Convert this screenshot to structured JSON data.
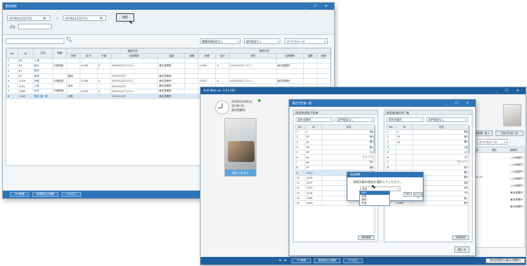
{
  "back_window": {
    "title": "勤怠検索",
    "controls": "_ ☐ ×",
    "date_from": "2019年12月27日",
    "date_to": "2019年12月27日",
    "range_sep": "〜",
    "name_label": "氏名",
    "search_button": "検索",
    "filters": [
      "職種所属指定なし",
      "部門指定なし",
      "すべてのデータ"
    ],
    "col_headers": {
      "no": "No.",
      "id": "ID",
      "name": "氏名",
      "work": "勤務",
      "group_left": "最新打刻",
      "group_right": "最終打刻",
      "sub": [
        "状態",
        "区分",
        "日時",
        "出勤場所",
        "温度",
        "画像"
      ]
    },
    "rows": [
      {
        "no": "1",
        "id": "98",
        "name": "小澤",
        "work": "",
        "state": "",
        "num": "",
        "cls": "",
        "time": "",
        "place": "",
        "r_num": "",
        "r_cls": "",
        "r_time": "",
        "r_place": ""
      },
      {
        "no": "2",
        "id": "66",
        "name": "藤木",
        "work": "中勤測定",
        "state": "",
        "num": "0.000",
        "cls": "A",
        "time": "2019/12/27 07:3...",
        "place": "東京営業所",
        "r_num": "0.000",
        "r_cls": "A",
        "r_time": "2019/12/27 17:1...",
        "r_place": "東京営業所"
      },
      {
        "no": "3",
        "id": "67",
        "name": "藤林",
        "work": "",
        "state": "",
        "num": "",
        "cls": "",
        "time": "",
        "place": "",
        "r_num": "",
        "r_cls": "",
        "r_time": "",
        "r_place": ""
      },
      {
        "no": "4",
        "id": "67",
        "name": "藤林",
        "work": "",
        "state": "遅刻",
        "num": "",
        "cls": "",
        "time": "2019/12/27",
        "place": "東京営業所",
        "r_num": "",
        "r_cls": "",
        "r_time": "",
        "r_place": ""
      },
      {
        "no": "5",
        "id": "1029",
        "name": "伊藤",
        "work": "中勤測定",
        "state": "",
        "num": "0.000",
        "cls": "A",
        "time": "2019/12/27 07:3...",
        "place": "東京営業所",
        "r_num": "0.000",
        "r_cls": "A",
        "r_time": "2019/12/27 17:1...",
        "r_place": "東京営業所"
      },
      {
        "no": "6",
        "id": "1051",
        "name": "九条",
        "work": "",
        "state": "休み",
        "num": "",
        "cls": "",
        "time": "2019/12/27",
        "place": "東京営業所",
        "r_num": "",
        "r_cls": "",
        "r_time": "",
        "r_place": ""
      },
      {
        "no": "7",
        "id": "1083",
        "name": "木村",
        "work": "中勤測定",
        "state": "",
        "num": "0.000",
        "cls": "A",
        "time": "2019/12/27 07:3...",
        "place": "東京営業所",
        "r_num": "",
        "r_cls": "",
        "r_time": "",
        "r_place": ""
      },
      {
        "no": "8",
        "id": "1139",
        "name": "野倉 康一郎",
        "work": "",
        "state": "出張",
        "num": "",
        "cls": "",
        "time": "2019/12/27",
        "place": "東京営業所",
        "r_num": "",
        "r_cls": "",
        "r_time": "",
        "r_place": ""
      }
    ],
    "bottom_buttons": [
      "TCP帳票",
      "勤務表出力帳票",
      "CSV出力"
    ]
  },
  "front_window": {
    "title": "ALD Web ver. 3.01.001",
    "controls": "_ ☐ ×",
    "date_line": "2019/12/26(木)",
    "time_line": "16:09:10",
    "place_line": "東京営業所",
    "camera_caption": "測定できます",
    "right_filters": [
      "勤務管理帳票一覧 ▸",
      "測定予定者一覧",
      "すべてのデータ"
    ],
    "right_cols": [
      "出社",
      "退社",
      "勤務所"
    ],
    "right_rows": [
      "□川東営所",
      "□川東営所",
      "□川東営所",
      "□川東営所",
      "□川東営所",
      "東京営業所",
      "東京営業所",
      "東京営業所"
    ],
    "right_value_row": "126/93  79",
    "bottom_buttons": [
      "TCP帳票",
      "勤務表出力帳票",
      "CSV出力"
    ],
    "bottom_right_button": "測定記録表示(最大2週間分)"
  },
  "dialog": {
    "title": "測定予定者一覧",
    "controls": "_ ☐ ×",
    "left_panel_title": "[測定前]測定予定者",
    "right_panel_title": "[測定後]測定完了者",
    "place_select": "東京営業所",
    "dept_select": "部門指定なし",
    "col_no": "No.",
    "col_id": "ID",
    "col_name": "氏名",
    "left_rows": [
      {
        "no": "1",
        "id": "2",
        "name": "桐谷"
      },
      {
        "no": "2",
        "id": "32",
        "name": "菊地"
      },
      {
        "no": "3",
        "id": "33",
        "name": "藤井"
      },
      {
        "no": "4",
        "id": "34",
        "name": "藤木"
      },
      {
        "no": "5",
        "id": "36",
        "name": "小澤"
      },
      {
        "no": "6",
        "id": "62",
        "name": "ブライアン"
      },
      {
        "no": "7",
        "id": "64",
        "name": "鈴木"
      },
      {
        "no": "8",
        "id": "67",
        "name": "藤林"
      },
      {
        "no": "9",
        "id": "1014",
        "name": "木村"
      },
      {
        "no": "10",
        "id": "1029",
        "name": "伊藤"
      },
      {
        "no": "11",
        "id": "1047",
        "name": "近衛"
      },
      {
        "no": "12",
        "id": "1047",
        "name": "近衛"
      },
      {
        "no": "13",
        "id": "1076",
        "name": "森山"
      },
      {
        "no": "14",
        "id": "1080",
        "name": "野見"
      },
      {
        "no": "15",
        "id": "1083",
        "name": "木村"
      }
    ],
    "right_rows": [
      {
        "no": "1",
        "id": "2",
        "name": "桐谷"
      },
      {
        "no": "2",
        "id": "32",
        "name": "菊地"
      },
      {
        "no": "3",
        "id": "33",
        "name": "藤井"
      },
      {
        "no": "4",
        "id": "",
        "name": "大野"
      },
      {
        "no": "5",
        "id": "",
        "name": "小澤"
      },
      {
        "no": "6",
        "id": "",
        "name": "立花"
      },
      {
        "no": "7",
        "id": "",
        "name": "ブライアン"
      },
      {
        "no": "8",
        "id": "",
        "name": "鈴木"
      },
      {
        "no": "9",
        "id": "",
        "name": "藤田"
      },
      {
        "no": "10",
        "id": "",
        "name": "野澤"
      },
      {
        "no": "11",
        "id": "1029",
        "name": "伊藤"
      },
      {
        "no": "12",
        "id": "1047",
        "name": "近衛"
      },
      {
        "no": "13",
        "id": "1051",
        "name": "九条"
      },
      {
        "no": "14",
        "id": "1076",
        "name": "森山"
      },
      {
        "no": "15",
        "id": "1080",
        "name": "野見"
      }
    ],
    "left_footer_button": "測定登録",
    "right_footer_button": "測定取消",
    "close_button": "閉じる"
  },
  "popup": {
    "title": "理由登録",
    "message": "長期欠勤の理由を選択してください。",
    "select_value": "休み",
    "ok_button": "OK",
    "cancel_button": "キャンセル",
    "options": [
      "休み",
      "出張",
      "遅刻",
      "早退"
    ]
  }
}
